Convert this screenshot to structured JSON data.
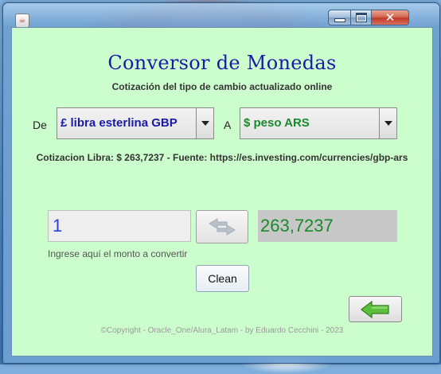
{
  "window": {
    "icon_glyph": "☕",
    "close_glyph": "✕"
  },
  "main": {
    "title": "Conversor de Monedas",
    "subtitle": "Cotización del tipo de cambio actualizado online",
    "from_label": "De",
    "from_currency": "£ libra esterlina GBP",
    "to_label": "A",
    "to_currency": "$ peso ARS",
    "rate_text": "Cotizacion Libra: $ 263,7237 - Fuente: https://es.investing.com/currencies/gbp-ars",
    "amount_value": "1",
    "amount_hint": "Ingrese aquí el monto a convertir",
    "result_value": "263,7237",
    "clean_label": "Clean",
    "copyright": "©Copyright - Oracle_One/Alura_Latam  - by Eduardo Cecchini - 2023"
  },
  "colors": {
    "content_bg": "#ccfdcc",
    "title": "#1a1aa8",
    "from_currency_text": "#1a1aa8",
    "to_currency_text": "#178a2a",
    "amount_text": "#2a3fd8",
    "result_text": "#178a2a",
    "back_arrow": "#4caf2a"
  },
  "icons": {
    "app": "java-cup-icon",
    "swap": "swap-arrows-icon",
    "back": "back-arrow-icon",
    "dropdown": "chevron-down-icon"
  }
}
